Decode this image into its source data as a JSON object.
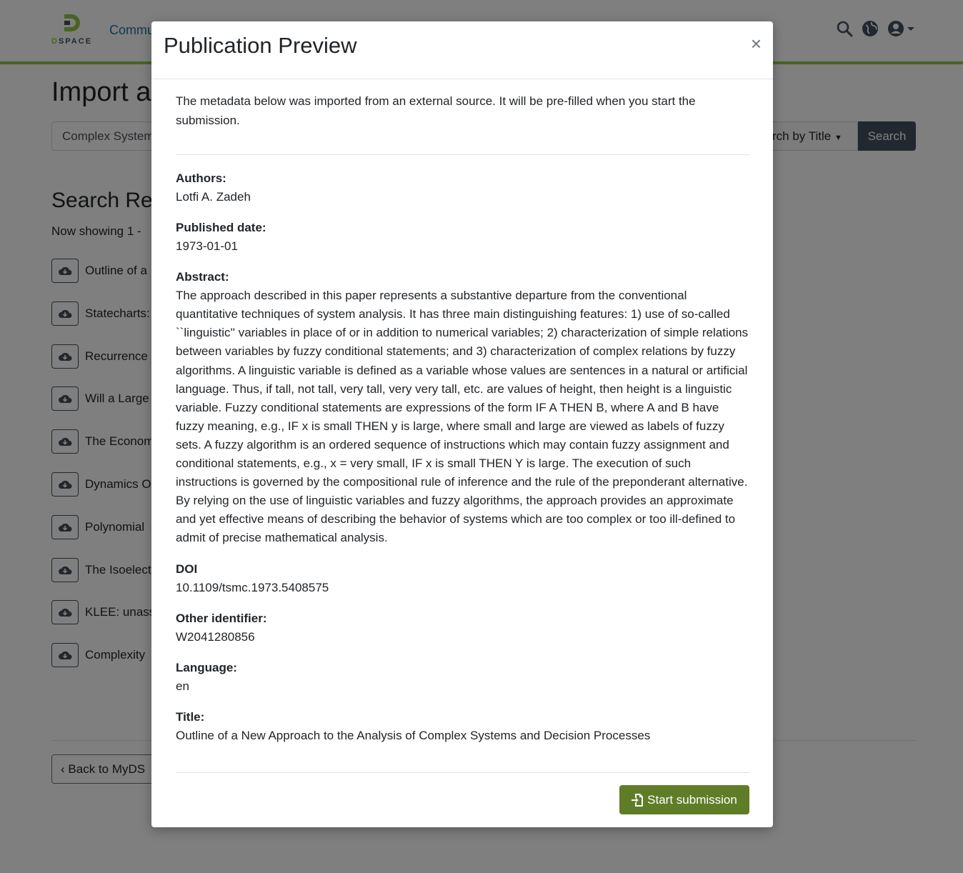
{
  "header": {
    "logo_text_a": "D",
    "logo_text_b": "SPACE",
    "nav_communities": "Commu"
  },
  "page": {
    "title": "Import a",
    "search_value": "Complex System",
    "search_select": "rch by Title",
    "search_button": "Search",
    "results_title": "Search Re",
    "now_showing": "Now showing 1 -",
    "results": [
      "Outline of a",
      "Statecharts:",
      "Recurrence",
      "Will a Large",
      "The Econom",
      "Dynamics O",
      "Polynomial",
      "The Isoelect",
      "KLEE: unass",
      "Complexity"
    ],
    "back_button": "Back to MyDS"
  },
  "modal": {
    "title": "Publication Preview",
    "close_label": "×",
    "intro": "The metadata below was imported from an external source. It will be pre-filled when you start the submission.",
    "fields": [
      {
        "label": "Authors:",
        "value": "Lotfi A. Zadeh"
      },
      {
        "label": "Published date:",
        "value": "1973-01-01"
      },
      {
        "label": "Abstract:",
        "value": "The approach described in this paper represents a substantive departure from the conventional quantitative techniques of system analysis. It has three main distinguishing features: 1) use of so-called ``linguistic'' variables in place of or in addition to numerical variables; 2) characterization of simple relations between variables by fuzzy conditional statements; and 3) characterization of complex relations by fuzzy algorithms. A linguistic variable is defined as a variable whose values are sentences in a natural or artificial language. Thus, if tall, not tall, very tall, very very tall, etc. are values of height, then height is a linguistic variable. Fuzzy conditional statements are expressions of the form IF A THEN B, where A and B have fuzzy meaning, e.g., IF x is small THEN y is large, where small and large are viewed as labels of fuzzy sets. A fuzzy algorithm is an ordered sequence of instructions which may contain fuzzy assignment and conditional statements, e.g., x = very small, IF x is small THEN Y is large. The execution of such instructions is governed by the compositional rule of inference and the rule of the preponderant alternative. By relying on the use of linguistic variables and fuzzy algorithms, the approach provides an approximate and yet effective means of describing the behavior of systems which are too complex or too ill-defined to admit of precise mathematical analysis."
      },
      {
        "label": "DOI",
        "value": "10.1109/tsmc.1973.5408575"
      },
      {
        "label": "Other identifier:",
        "value": "W2041280856"
      },
      {
        "label": "Language:",
        "value": "en"
      },
      {
        "label": "Title:",
        "value": "Outline of a New Approach to the Analysis of Complex Systems and Decision Processes"
      }
    ],
    "start_button": "Start submission"
  },
  "colors": {
    "brand_green": "#92c642",
    "start_button": "#5f7d27",
    "dark": "#43515f",
    "link": "#207698"
  },
  "icons": [
    "search-icon",
    "globe-icon",
    "user-icon",
    "cloud-download-icon",
    "chevron-left-icon",
    "file-import-icon",
    "close-icon"
  ]
}
